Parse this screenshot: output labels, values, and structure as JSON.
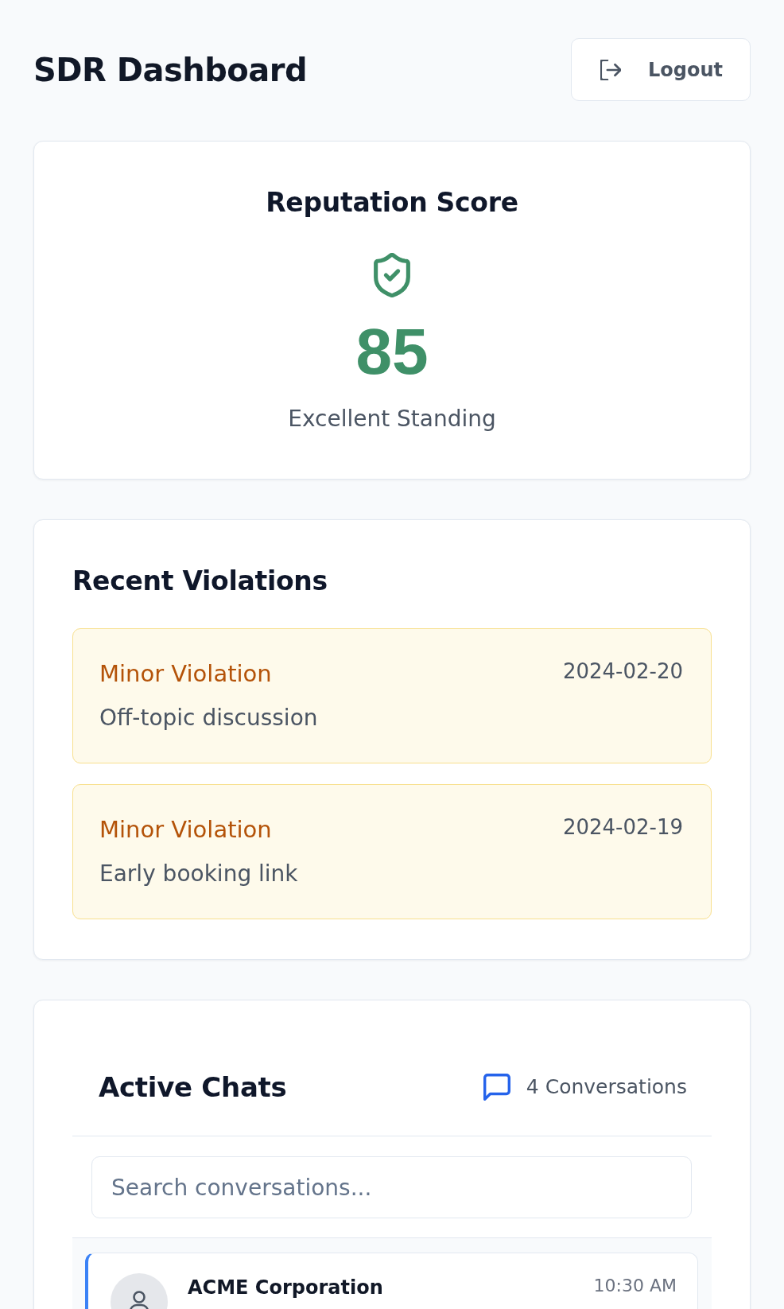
{
  "header": {
    "title": "SDR Dashboard",
    "logout_button": {
      "label": "Logout"
    }
  },
  "reputation": {
    "title": "Reputation Score",
    "score": "85",
    "standing": "Excellent Standing"
  },
  "violations": {
    "title": "Recent Violations",
    "items": [
      {
        "kind": "minor",
        "severity": "Minor Violation",
        "date": "2024-02-20",
        "description": "Off-topic discussion"
      },
      {
        "kind": "minor",
        "severity": "Minor Violation",
        "date": "2024-02-19",
        "description": "Early booking link"
      }
    ]
  },
  "active_chats": {
    "title": "Active Chats",
    "count": "4 Conversations",
    "search": {
      "placeholder": "Search conversations..."
    },
    "chats": [
      {
        "name": "ACME Corporation",
        "time": "10:30 AM",
        "selected": true
      }
    ]
  }
}
